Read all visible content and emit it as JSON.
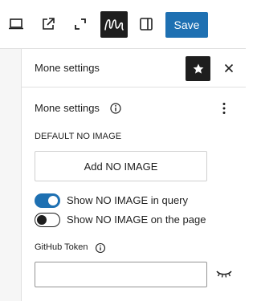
{
  "toolbar": {
    "save_label": "Save",
    "icons": [
      "desktop-preview-icon",
      "external-link-icon",
      "fullscreen-icon",
      "plugin-logo-icon",
      "sidebar-toggle-icon"
    ]
  },
  "sidebar": {
    "title": "Mone settings",
    "star_icon": "star-icon",
    "close_icon": "close-icon"
  },
  "panel": {
    "title": "Mone settings",
    "section_label": "DEFAULT NO IMAGE",
    "add_button_label": "Add NO IMAGE",
    "toggles": [
      {
        "label": "Show NO IMAGE in query",
        "checked": true
      },
      {
        "label": "Show NO IMAGE on the page",
        "checked": false
      }
    ],
    "token_label": "GitHub Token",
    "token_value": "",
    "accent_color": "#1e70b2"
  }
}
